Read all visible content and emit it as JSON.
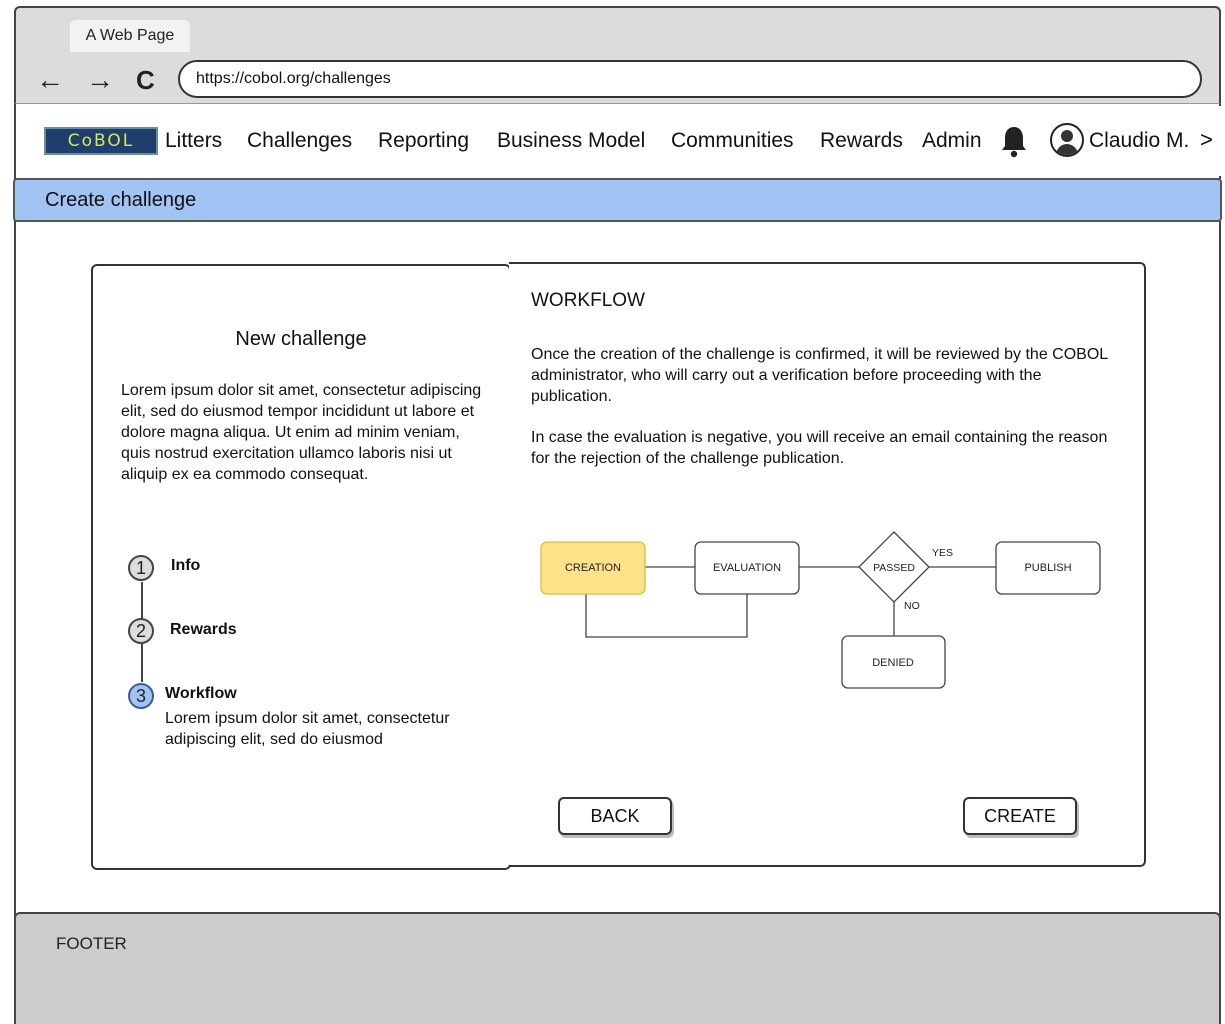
{
  "browser": {
    "tab_title": "A Web Page",
    "url": "https://cobol.org/challenges",
    "back_glyph": "←",
    "forward_glyph": "→",
    "reload_glyph": "C"
  },
  "topnav": {
    "logo": "CoBOL",
    "items": [
      "Litters",
      "Challenges",
      "Reporting",
      "Business Model",
      "Communities",
      "Rewards",
      "Admin"
    ],
    "notification_icon": "bell-icon",
    "user_icon": "user-avatar-icon",
    "user_name": "Claudio M.",
    "user_chevron": ">"
  },
  "page": {
    "title": "Create challenge"
  },
  "left_panel": {
    "title": "New challenge",
    "description": "Lorem ipsum dolor sit amet, consectetur adipiscing elit, sed do eiusmod tempor incididunt ut labore et dolore magna aliqua. Ut enim ad minim veniam, quis nostrud exercitation ullamco laboris nisi ut aliquip ex ea commodo consequat.",
    "steps": [
      {
        "number": "1",
        "label": "Info"
      },
      {
        "number": "2",
        "label": "Rewards"
      },
      {
        "number": "3",
        "label": "Workflow",
        "description": "Lorem ipsum dolor sit amet, consectetur adipiscing elit, sed do eiusmod"
      }
    ],
    "active_step": 3
  },
  "workflow": {
    "title": "WORKFLOW",
    "paragraph1": "Once the creation of the challenge is confirmed, it will be reviewed by the COBOL administrator, who will carry out a verification before proceeding with the publication.",
    "paragraph2": "In case the evaluation is negative, you will receive an email containing the reason for the rejection of the challenge publication.",
    "diagram": {
      "creation": "CREATION",
      "evaluation": "EVALUATION",
      "passed": "PASSED",
      "publish": "PUBLISH",
      "denied": "DENIED",
      "yes": "YES",
      "no": "NO"
    },
    "back_label": "BACK",
    "create_label": "CREATE"
  },
  "footer": {
    "label": "FOOTER"
  },
  "colors": {
    "title_bar": "#a2c4f5",
    "creation_node": "#fde28a",
    "active_step": "#a2c4f5",
    "footer": "#cccccc"
  }
}
